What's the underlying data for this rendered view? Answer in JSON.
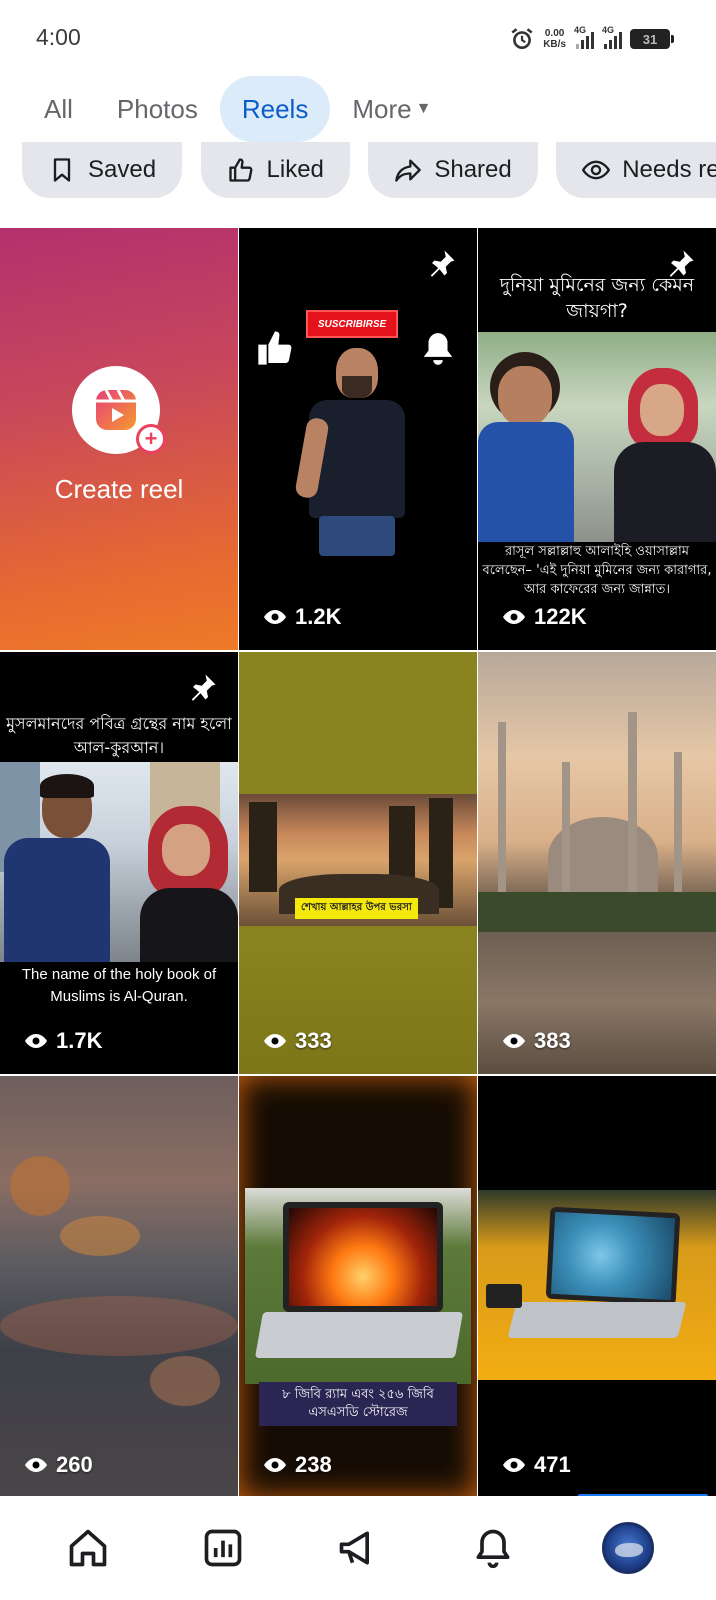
{
  "status_bar": {
    "time": "4:00",
    "speed_value": "0.00",
    "speed_unit": "KB/s",
    "net1": "4G",
    "net2": "4G",
    "battery": "31"
  },
  "tabs": [
    {
      "label": "All",
      "active": false
    },
    {
      "label": "Photos",
      "active": false
    },
    {
      "label": "Reels",
      "active": true
    },
    {
      "label": "More",
      "active": false
    }
  ],
  "chips": [
    {
      "label": "Saved",
      "icon": "bookmark-icon"
    },
    {
      "label": "Liked",
      "icon": "thumbs-up-icon"
    },
    {
      "label": "Shared",
      "icon": "share-icon"
    },
    {
      "label": "Needs revie",
      "icon": "eye-icon"
    }
  ],
  "create_reel": {
    "label": "Create reel"
  },
  "reels": [
    {
      "views": "1.2K",
      "pinned": true,
      "badge": "SUSCRIBIRSE"
    },
    {
      "views": "122K",
      "pinned": true,
      "top_text": "দুনিয়া মুমিনের জন্য কেমন জায়গা?",
      "bottom_text": "রাসূল সল্লাল্লাহু আলাইহি ওয়াসাল্লাম বলেছেন– 'এই দুনিয়া মুমিনের জন্য কারাগার, আর কাফেরের জন্য জান্নাত।"
    },
    {
      "views": "1.7K",
      "pinned": true,
      "top_text": "মুসলমানদের পবিত্র গ্রন্থের নাম হলো আল-কুরআন।",
      "bottom_text": "The name of the holy book of Muslims is Al-Quran."
    },
    {
      "views": "333",
      "overlay_text": "শেখায় আল্লাহর উপর ভরসা"
    },
    {
      "views": "383"
    },
    {
      "views": "260"
    },
    {
      "views": "238",
      "overlay_text": "৮ জিবি র‍্যাম এবং ২৫৬ জিবি এসএসডি স্টোরেজ"
    },
    {
      "views": "471"
    }
  ],
  "bottom_nav": [
    {
      "icon": "home-icon"
    },
    {
      "icon": "dashboard-icon"
    },
    {
      "icon": "megaphone-icon"
    },
    {
      "icon": "bell-icon"
    },
    {
      "icon": "profile-avatar"
    }
  ],
  "colors": {
    "accent": "#0b5ec9",
    "active_tab_bg": "#dcebfa",
    "chip_bg": "#e4e6eb"
  }
}
